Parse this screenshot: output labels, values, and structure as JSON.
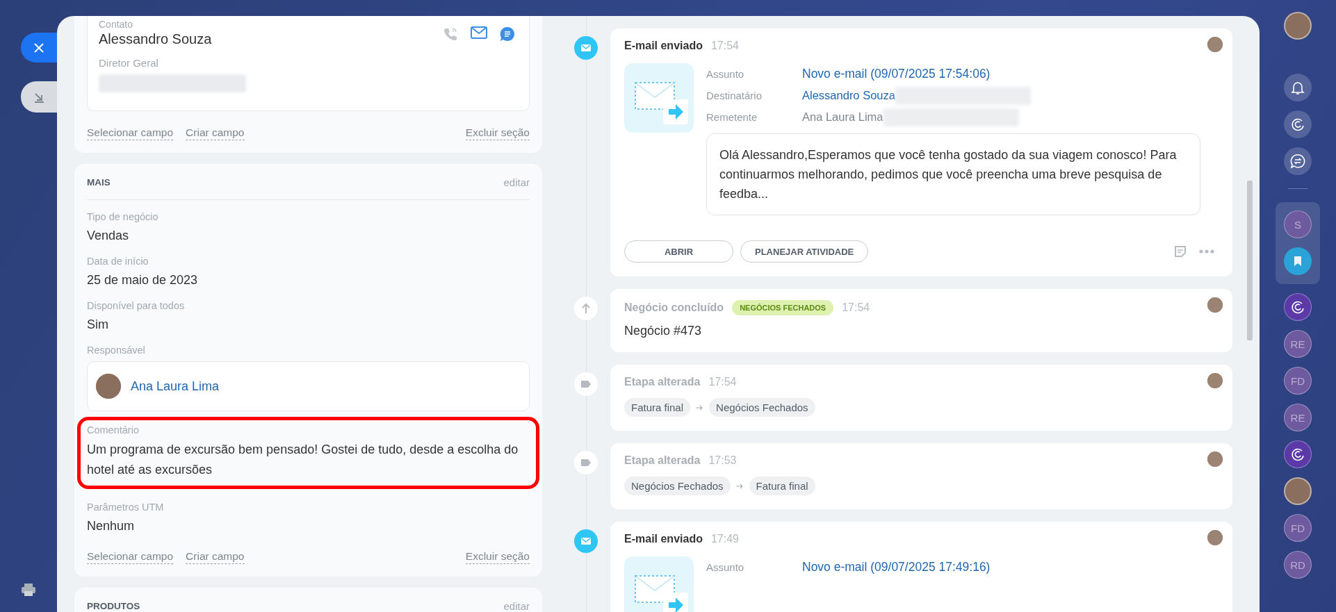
{
  "left_panel": {
    "contact_section": {
      "contact": {
        "label": "Contato",
        "name": "Alessandro Souza",
        "position": "Diretor Geral"
      },
      "links": [
        "Selecionar campo",
        "Criar campo"
      ],
      "delete_link": "Excluir seção"
    },
    "more_section": {
      "title": "MAIS",
      "edit": "editar",
      "fields": [
        {
          "kind": "text",
          "label": "Tipo de negócio",
          "value": "Vendas",
          "highlighted": false
        },
        {
          "kind": "text",
          "label": "Data de início",
          "value": "25 de maio de 2023",
          "highlighted": false
        },
        {
          "kind": "text",
          "label": "Disponível para todos",
          "value": "Sim",
          "highlighted": false
        },
        {
          "kind": "person",
          "label": "Responsável",
          "value": "Ana Laura Lima",
          "highlighted": false
        },
        {
          "kind": "text",
          "label": "Comentário",
          "value": "Um programa de excursão bem pensado! Gostei de tudo, desde a escolha do hotel até as excursões",
          "highlighted": true
        },
        {
          "kind": "text",
          "label": "Parâmetros UTM",
          "value": "Nenhum",
          "highlighted": false
        }
      ],
      "links": [
        "Selecionar campo",
        "Criar campo"
      ],
      "delete_link": "Excluir seção"
    },
    "products_section": {
      "title": "PRODUTOS",
      "edit": "editar"
    }
  },
  "timeline": [
    {
      "kind": "email",
      "title": "E-mail enviado",
      "time": "17:54",
      "fields": [
        {
          "label": "Assunto",
          "value": "Novo e-mail (09/07/2025 17:54:06)",
          "link": true,
          "redacted": false
        },
        {
          "label": "Destinatário",
          "value": "Alessandro Souza",
          "link": true,
          "redacted": true
        },
        {
          "label": "Remetente",
          "value": "Ana Laura Lima",
          "link": false,
          "redacted": true
        }
      ],
      "body": "Olá Alessandro,Esperamos que você tenha gostado da sua viagem conosco! Para continuarmos melhorando, pedimos que você preencha uma breve pesquisa de feedba...",
      "buttons": [
        "ABRIR",
        "PLANEJAR ATIVIDADE"
      ]
    },
    {
      "kind": "deal",
      "title": "Negócio concluído",
      "badge": "NEGÓCIOS FECHADOS",
      "time": "17:54",
      "text": "Negócio #473"
    },
    {
      "kind": "stage",
      "title": "Etapa alterada",
      "time": "17:54",
      "from": "Fatura final",
      "to": "Negócios Fechados"
    },
    {
      "kind": "stage",
      "title": "Etapa alterada",
      "time": "17:53",
      "from": "Negócios Fechados",
      "to": "Fatura final"
    },
    {
      "kind": "email",
      "title": "E-mail enviado",
      "time": "17:49",
      "fields": [
        {
          "label": "Assunto",
          "value": "Novo e-mail (09/07/2025 17:49:16)",
          "link": true,
          "redacted": false
        }
      ]
    }
  ],
  "sidebar": [
    {
      "kind": "photo"
    },
    {
      "kind": "bell"
    },
    {
      "kind": "copilot"
    },
    {
      "kind": "chat"
    },
    {
      "kind": "divider"
    },
    {
      "kind": "initials",
      "text": "S",
      "pinned": true
    },
    {
      "kind": "bookmark",
      "pinned": true
    },
    {
      "kind": "spiral",
      "pinned": false
    },
    {
      "kind": "initials",
      "text": "RE",
      "pinned": false
    },
    {
      "kind": "initials",
      "text": "FD",
      "pinned": false
    },
    {
      "kind": "initials",
      "text": "RE",
      "pinned": false
    },
    {
      "kind": "spiral",
      "pinned": false
    },
    {
      "kind": "photo",
      "pinned": false
    },
    {
      "kind": "initials",
      "text": "FD",
      "pinned": false
    },
    {
      "kind": "initials",
      "text": "RD",
      "pinned": false
    }
  ]
}
